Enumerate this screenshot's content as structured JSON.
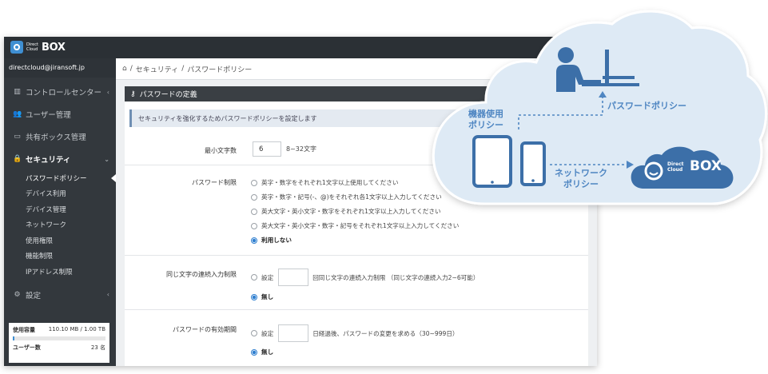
{
  "app": {
    "logo_small": "Direct Cloud",
    "logo_box": "BOX",
    "account": "directcloud@jiransoft.jp"
  },
  "sidebar": {
    "items": [
      {
        "label": "コントロールセンター",
        "icon": "bar-chart-icon"
      },
      {
        "label": "ユーザー管理",
        "icon": "users-icon"
      },
      {
        "label": "共有ボックス管理",
        "icon": "hdd-icon"
      },
      {
        "label": "セキュリティ",
        "icon": "lock-icon"
      },
      {
        "label": "設定",
        "icon": "gear-icon"
      }
    ],
    "security_sub": [
      "パスワードポリシー",
      "デバイス利用",
      "デバイス管理",
      "ネットワーク",
      "使用権限",
      "機能制限",
      "IPアドレス制限"
    ],
    "usage": {
      "capacity_label": "使用容量",
      "capacity_value": "110.10 MB / 1.00 TB",
      "capacity_fraction": 0.0001,
      "users_label": "ユーザー数",
      "users_value": "23 名"
    }
  },
  "breadcrumb": {
    "home_icon": "home-icon",
    "security": "セキュリティ",
    "sep": "/",
    "current": "パスワードポリシー"
  },
  "panel": {
    "title": "パスワードの定義",
    "notice": "セキュリティを強化するためパスワードポリシーを設定します",
    "min_length": {
      "label": "最小文字数",
      "value": "6",
      "hint": "8~32文字"
    },
    "restriction": {
      "label": "パスワード制限",
      "options": [
        "英字・数字をそれぞれ1文字以上使用してください",
        "英字・数字・記号(-、@)をそれぞれ各1文字以上入力してください",
        "英大文字・英小文字・数字をそれぞれ1文字以上入力してください",
        "英大文字・英小文字・数字・記号をそれぞれ1文字以上入力してください",
        "利用しない"
      ],
      "selected": 4
    },
    "consecutive": {
      "label": "同じ文字の連続入力制限",
      "set_label": "設定",
      "description": "回同じ文字の連続入力制限 （同じ文字の連続入力2~6可能）",
      "none_label": "無し",
      "selected": "none"
    },
    "expiry": {
      "label": "パスワードの有効期間",
      "set_label": "設定",
      "description": "日経過後、パスワードの変更を求める（30~999日）",
      "none_label": "無し",
      "selected": "none"
    }
  },
  "illustration": {
    "password_policy": "パスワードポリシー",
    "device_policy": "機器使用 ポリシー",
    "device_policy_1": "機器使用",
    "device_policy_2": "ポリシー",
    "network_policy_1": "ネットワーク",
    "network_policy_2": "ポリシー",
    "logo_small_1": "Direct",
    "logo_small_2": "Cloud",
    "logo_box": "BOX",
    "colors": {
      "cloud_fill": "#deeaf5",
      "accent": "#4f86c2",
      "dark_blue": "#3c6fa8"
    }
  }
}
